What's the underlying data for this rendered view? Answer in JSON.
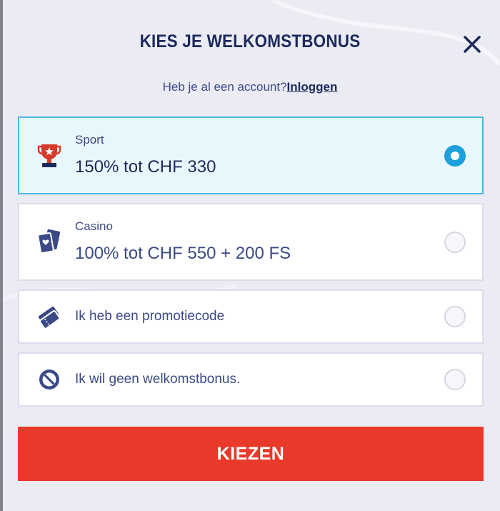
{
  "title": "KIES JE WELKOMSTBONUS",
  "login": {
    "prompt": "Heb je al een account?",
    "link": "Inloggen"
  },
  "options": [
    {
      "label": "Sport",
      "value": "150% tot CHF 330",
      "icon": "trophy-icon",
      "selected": true
    },
    {
      "label": "Casino",
      "value": "100% tot CHF 550 + 200 FS",
      "icon": "cards-icon",
      "selected": false
    },
    {
      "text": "Ik heb een promotiecode",
      "icon": "ticket-icon",
      "selected": false
    },
    {
      "text": "Ik wil geen welkomstbonus.",
      "icon": "forbidden-icon",
      "selected": false
    }
  ],
  "cta": {
    "label": "KIEZEN"
  },
  "colors": {
    "navy": "#1c2a5c",
    "accent": "#e8392a",
    "selected_border": "#4fb7e6",
    "radio_on": "#1ea0dc"
  }
}
